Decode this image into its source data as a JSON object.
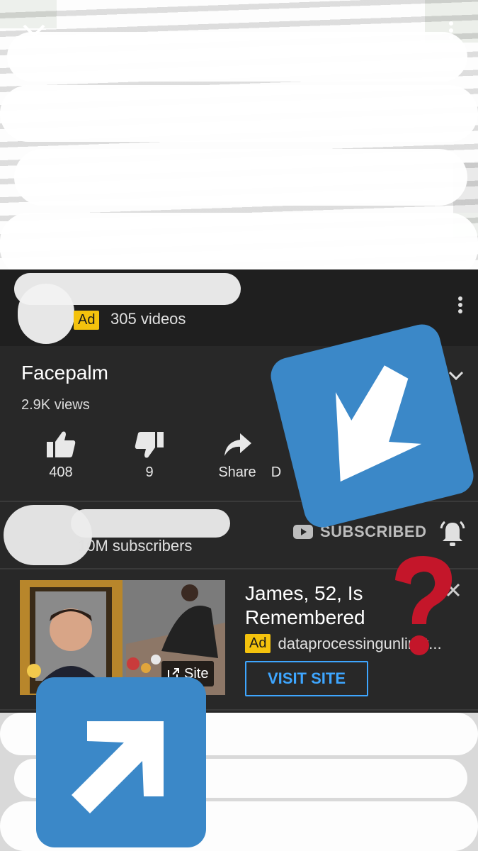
{
  "playlist": {
    "ad_label": "Ad",
    "video_count": "305 videos"
  },
  "video": {
    "title": "Facepalm",
    "views": "2.9K views"
  },
  "actions": {
    "like_count": "408",
    "dislike_count": "9",
    "share_label": "Share",
    "download_label_partial": "D"
  },
  "channel": {
    "subscribers": "10M subscribers",
    "subscribed_label": "SUBSCRIBED"
  },
  "ad_card": {
    "title": "James, 52, Is Remembered",
    "ad_label": "Ad",
    "domain": "dataprocessingunlimit...",
    "cta": "VISIT SITE",
    "site_label": "Site"
  },
  "colors": {
    "background": "#282828",
    "accent_blue": "#3ea6ff",
    "ad_yellow": "#f4c20d",
    "overlay_blue": "#3b88c8",
    "question_red": "#c4162a"
  }
}
